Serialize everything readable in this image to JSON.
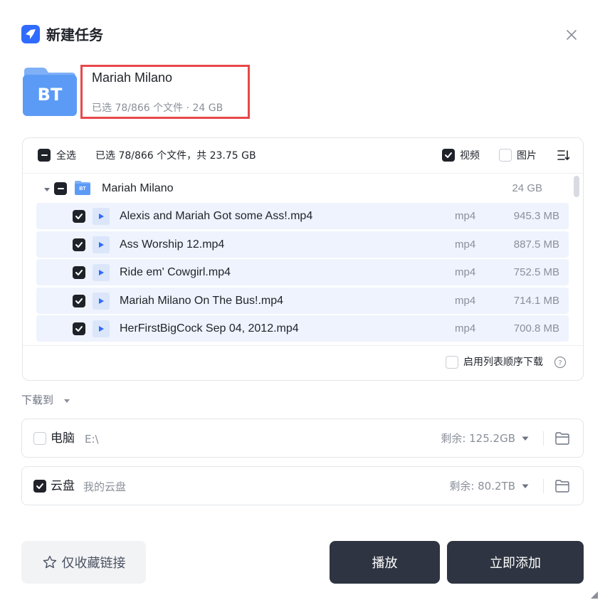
{
  "header": {
    "title": "新建任务",
    "logo_icon": "feather-logo-icon",
    "close_icon": "close-icon"
  },
  "task": {
    "badge": "BT",
    "name": "Mariah Milano",
    "meta": "已选 78/866 个文件 · 24 GB"
  },
  "file_panel": {
    "select_all_label": "全选",
    "selection_summary": "已选 78/866 个文件，共 23.75 GB",
    "filter_video_label": "视频",
    "filter_video_checked": true,
    "filter_image_label": "图片",
    "filter_image_checked": false,
    "sort_icon": "sort-icon",
    "folder": {
      "name": "Mariah Milano",
      "size": "24 GB",
      "badge": "BT"
    },
    "files": [
      {
        "name": "Alexis and Mariah Got some Ass!.mp4",
        "type": "mp4",
        "size": "945.3 MB",
        "checked": true
      },
      {
        "name": "Ass Worship 12.mp4",
        "type": "mp4",
        "size": "887.5 MB",
        "checked": true
      },
      {
        "name": "Ride em' Cowgirl.mp4",
        "type": "mp4",
        "size": "752.5 MB",
        "checked": true
      },
      {
        "name": "Mariah Milano On The Bus!.mp4",
        "type": "mp4",
        "size": "714.1 MB",
        "checked": true
      },
      {
        "name": "HerFirstBigCock Sep 04, 2012.mp4",
        "type": "mp4",
        "size": "700.8 MB",
        "checked": true
      }
    ],
    "sequential_label": "启用列表顺序下载",
    "sequential_checked": false
  },
  "download": {
    "label": "下载到",
    "destinations": [
      {
        "name": "电脑",
        "path": "E:\\",
        "free": "剩余: 125.2GB",
        "checked": false
      },
      {
        "name": "云盘",
        "path": "我的云盘",
        "free": "剩余: 80.2TB",
        "checked": true
      }
    ]
  },
  "actions": {
    "favorite_label": "仅收藏链接",
    "play_label": "播放",
    "add_label": "立即添加"
  },
  "colors": {
    "accent": "#2f6bff",
    "highlight_box": "#e8484a",
    "dark_button": "#2e3441",
    "row_bg": "#eef3fd"
  }
}
